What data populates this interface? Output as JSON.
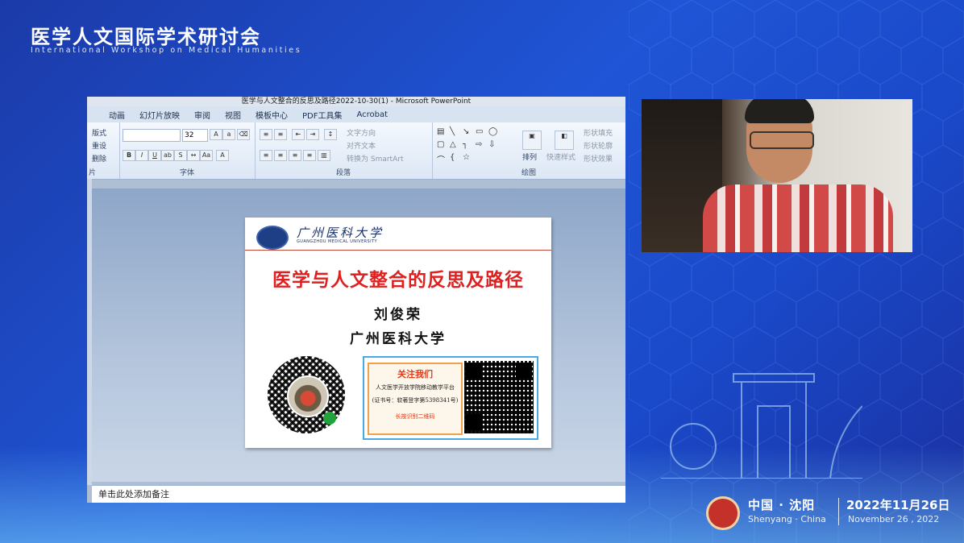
{
  "event": {
    "title": "医学人文国际学术研讨会",
    "subtitle": "International Workshop on Medical Humanities"
  },
  "ppt": {
    "window_title": "医学与人文整合的反思及路径2022-10-30(1) - Microsoft PowerPoint",
    "tabs": [
      "动画",
      "幻灯片放映",
      "审阅",
      "视图",
      "模板中心",
      "PDF工具集",
      "Acrobat"
    ],
    "ribbon": {
      "slides_group": [
        "版式",
        "重设",
        "删除"
      ],
      "font_size": "32",
      "font_group_label": "字体",
      "paragraph_group_label": "段落",
      "drawing_group_label": "绘图",
      "slides_group_label": "片",
      "text_direction": "文字方向",
      "align_text": "对齐文本",
      "convert_smartart": "转换为 SmartArt",
      "arrange": "排列",
      "quick_styles": "快速样式",
      "shape_fill": "形状填充",
      "shape_outline": "形状轮廓",
      "shape_effects": "形状效果"
    },
    "notes_placeholder": "单击此处添加备注"
  },
  "slide": {
    "univ_name": "广州医科大学",
    "univ_name_en": "GUANGZHOU MEDICAL UNIVERSITY",
    "title": "医学与人文整合的反思及路径",
    "author": "刘俊荣",
    "institution": "广州医科大学",
    "follow": {
      "title": "关注我们",
      "line1": "人文医学开放学院移动教学平台",
      "line2": "(证书号：软著登字第5398341号)",
      "line3": "长按识别二维码"
    }
  },
  "footer": {
    "city_cn": "中国 · 沈阳",
    "city_en": "Shenyang · China",
    "date_cn": "2022年11月26日",
    "date_en": "November 26 , 2022"
  },
  "colors": {
    "background": "#1f55d6",
    "slide_title": "#e02020",
    "accent_red": "#c3312a"
  }
}
